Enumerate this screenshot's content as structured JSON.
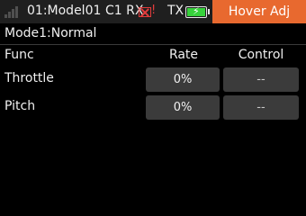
{
  "statusbar": {
    "model": "01:Model01",
    "rx_label": "C1 RX",
    "rx_alert": "!",
    "tx_label": "TX",
    "tab_title": "Hover Adj",
    "accent_color": "#e8692f",
    "rx_error_color": "#e23c3c",
    "battery_color": "#37d23c",
    "battery_level": 1.0,
    "bolt": "⚡"
  },
  "mode": "Mode1:Normal",
  "table": {
    "headers": {
      "func": "Func",
      "rate": "Rate",
      "control": "Control"
    },
    "rows": [
      {
        "func": "Throttle",
        "rate": "0%",
        "control": "--"
      },
      {
        "func": "Pitch",
        "rate": "0%",
        "control": "--"
      }
    ]
  }
}
